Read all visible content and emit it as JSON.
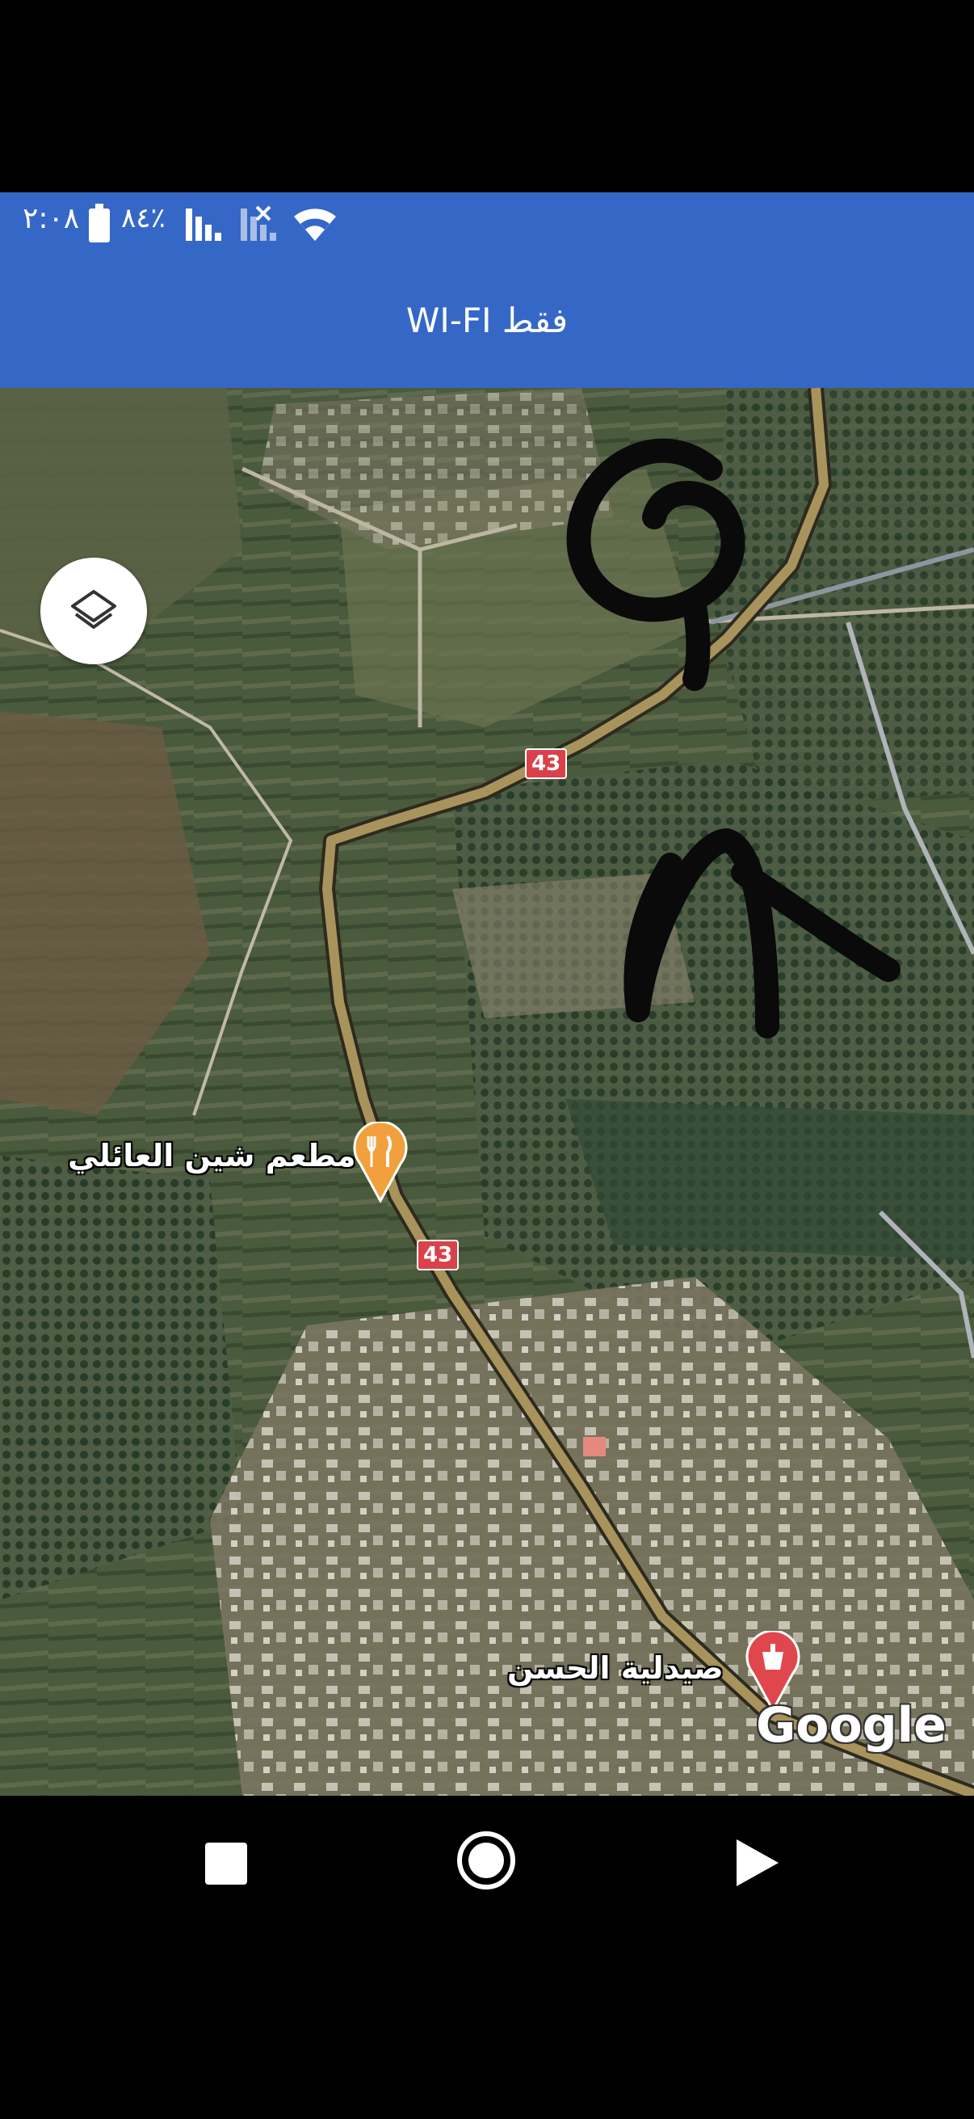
{
  "status_bar": {
    "time": "٢:٠٨",
    "battery_percent": "٨٤٪"
  },
  "app_bar": {
    "title": "WI-FI فقط"
  },
  "map": {
    "type": "satellite",
    "places": [
      {
        "name": "مطعم شين العائلي",
        "category": "restaurant",
        "pin_color": "#f2a03d"
      },
      {
        "name": "صيدلية الحسن",
        "category": "pharmacy",
        "pin_color": "#e0474c"
      }
    ],
    "route_badges": [
      "43",
      "43"
    ],
    "attribution": "Google",
    "layers_icon": "layers-icon"
  },
  "colors": {
    "app_bar": "#3568c6",
    "road": "#a8935c",
    "route_badge": "#d9414b"
  },
  "nav_bar": {
    "icons": [
      "recent-apps-icon",
      "home-icon",
      "back-icon"
    ]
  }
}
